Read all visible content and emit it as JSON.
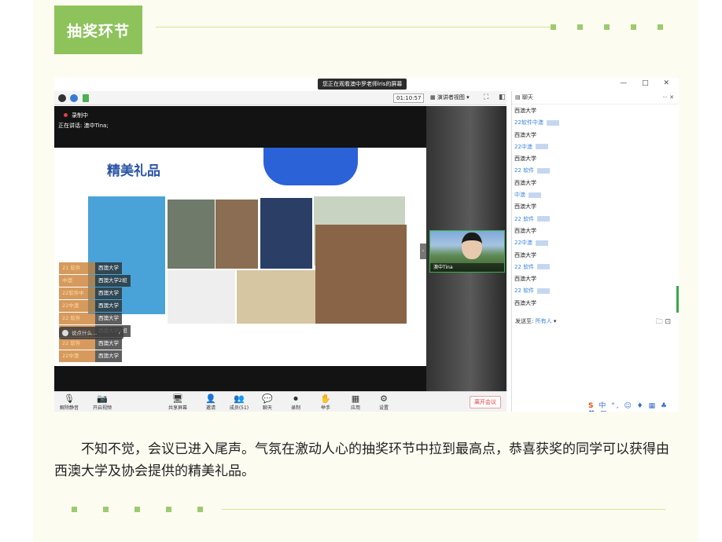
{
  "section_title": "抽奖环节",
  "screen": {
    "share_banner": "您正在观看澳中罗老师lris的屏幕",
    "window_controls": "—  □  ✕",
    "timer": "01:10:57",
    "view_mode": "演讲者视图",
    "recording_label": "录制中",
    "speaking_label": "正在讲话: 澳中Tina;",
    "slide_title": "精美礼品",
    "chat_overlay": [
      {
        "sender": "21 软件",
        "text": "西澳大学"
      },
      {
        "sender": "中澳",
        "text": "西澳大学2班"
      },
      {
        "sender": "22软件中",
        "text": "西澳大学"
      },
      {
        "sender": "22中澳",
        "text": "西澳大学"
      },
      {
        "sender": "22 软件",
        "text": "西澳大学"
      },
      {
        "sender": "中澳",
        "text": "西澳大学2班"
      },
      {
        "sender": "22 软件",
        "text": "西澳大学"
      },
      {
        "sender": "22中澳",
        "text": "西澳大学"
      }
    ],
    "chat_input_placeholder": "说点什么...",
    "video_name": "澳中Tina",
    "chat_panel_title": "聊天",
    "chat_panel_ctrls": "··· ✕",
    "chat_messages": [
      {
        "type": "msg",
        "text": "西澳大学"
      },
      {
        "type": "sender",
        "text": "22软件中澳"
      },
      {
        "type": "msg",
        "text": "西澳大学"
      },
      {
        "type": "sender",
        "text": "22中澳"
      },
      {
        "type": "msg",
        "text": "西澳大学"
      },
      {
        "type": "sender",
        "text": "22 软件"
      },
      {
        "type": "msg",
        "text": "西澳大学"
      },
      {
        "type": "sender",
        "text": "中澳"
      },
      {
        "type": "msg",
        "text": "西澳大学"
      },
      {
        "type": "sender",
        "text": "22 软件"
      },
      {
        "type": "msg",
        "text": "西澳大学"
      },
      {
        "type": "sender",
        "text": "22中澳"
      },
      {
        "type": "msg",
        "text": "西澳大学"
      },
      {
        "type": "sender",
        "text": "22 软件"
      },
      {
        "type": "msg",
        "text": "西澳大学"
      },
      {
        "type": "sender",
        "text": "22 软件"
      },
      {
        "type": "msg",
        "text": "西澳大学"
      }
    ],
    "send_to_label": "发送至:",
    "send_to_value": "所有人",
    "bottom_bar": [
      {
        "icon": "🎙",
        "label": "解除静音"
      },
      {
        "icon": "📷",
        "label": "开启视频"
      },
      {
        "icon": "🖥",
        "label": "共享屏幕"
      },
      {
        "icon": "👤",
        "label": "邀请"
      },
      {
        "icon": "👥",
        "label": "成员(51)"
      },
      {
        "icon": "💬",
        "label": "聊天"
      },
      {
        "icon": "⏺",
        "label": "录制"
      },
      {
        "icon": "✋",
        "label": "举手"
      },
      {
        "icon": "▦",
        "label": "应用"
      },
      {
        "icon": "⚙",
        "label": "设置"
      }
    ],
    "end_meeting": "离开会议",
    "taskbar": "中 °, ☺ ♦ ▦ ♣ ♥ ▩"
  },
  "caption": "不知不觉，会议已进入尾声。气氛在激动人心的抽奖环节中拉到最高点，恭喜获奖的同学可以获得由西澳大学及协会提供的精美礼品。"
}
